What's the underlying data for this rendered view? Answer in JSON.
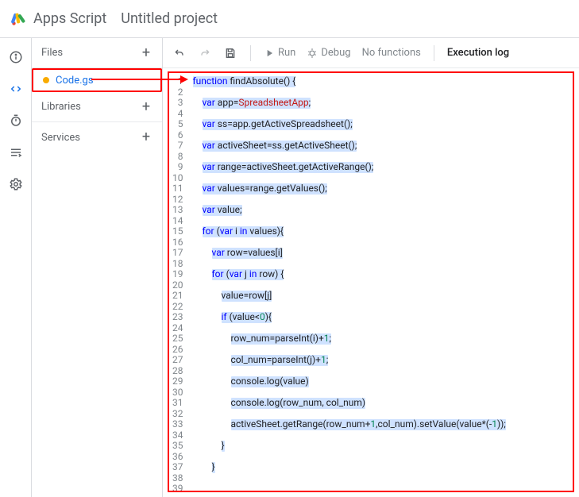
{
  "header": {
    "product": "Apps Script",
    "project_title": "Untitled project"
  },
  "sidebar": {
    "files_label": "Files",
    "file_name": "Code.gs",
    "libraries_label": "Libraries",
    "services_label": "Services"
  },
  "toolbar": {
    "run": "Run",
    "debug": "Debug",
    "no_functions": "No functions",
    "exec_log": "Execution log"
  },
  "code_lines": [
    {
      "indent": 0,
      "hl": true,
      "txt": "function findAbsolute() {"
    },
    {
      "indent": 0,
      "hl": false,
      "txt": ""
    },
    {
      "indent": 1,
      "hl": true,
      "txt": "var app=SpreadsheetApp;"
    },
    {
      "indent": 0,
      "hl": false,
      "txt": ""
    },
    {
      "indent": 1,
      "hl": true,
      "txt": "var ss=app.getActiveSpreadsheet();"
    },
    {
      "indent": 0,
      "hl": false,
      "txt": ""
    },
    {
      "indent": 1,
      "hl": true,
      "txt": "var activeSheet=ss.getActiveSheet();"
    },
    {
      "indent": 0,
      "hl": false,
      "txt": ""
    },
    {
      "indent": 1,
      "hl": true,
      "txt": "var range=activeSheet.getActiveRange();"
    },
    {
      "indent": 0,
      "hl": false,
      "txt": ""
    },
    {
      "indent": 1,
      "hl": true,
      "txt": "var values=range.getValues();"
    },
    {
      "indent": 0,
      "hl": false,
      "txt": ""
    },
    {
      "indent": 1,
      "hl": true,
      "txt": "var value;"
    },
    {
      "indent": 0,
      "hl": false,
      "txt": ""
    },
    {
      "indent": 1,
      "hl": true,
      "txt": "for (var i in values){"
    },
    {
      "indent": 1,
      "hl": false,
      "txt": ""
    },
    {
      "indent": 2,
      "hl": true,
      "txt": "var row=values[i]"
    },
    {
      "indent": 1,
      "hl": false,
      "txt": ""
    },
    {
      "indent": 2,
      "hl": true,
      "txt": "for (var j in row) {"
    },
    {
      "indent": 2,
      "hl": false,
      "txt": ""
    },
    {
      "indent": 3,
      "hl": true,
      "txt": "value=row[j]"
    },
    {
      "indent": 2,
      "hl": false,
      "txt": ""
    },
    {
      "indent": 3,
      "hl": true,
      "txt": "if (value<0){"
    },
    {
      "indent": 3,
      "hl": false,
      "txt": ""
    },
    {
      "indent": 4,
      "hl": true,
      "txt": "row_num=parseInt(i)+1;"
    },
    {
      "indent": 3,
      "hl": false,
      "txt": ""
    },
    {
      "indent": 4,
      "hl": true,
      "txt": "col_num=parseInt(j)+1;"
    },
    {
      "indent": 3,
      "hl": false,
      "txt": ""
    },
    {
      "indent": 4,
      "hl": true,
      "txt": "console.log(value)"
    },
    {
      "indent": 3,
      "hl": false,
      "txt": ""
    },
    {
      "indent": 4,
      "hl": true,
      "txt": "console.log(row_num, col_num)"
    },
    {
      "indent": 3,
      "hl": false,
      "txt": ""
    },
    {
      "indent": 4,
      "hl": true,
      "txt": "activeSheet.getRange(row_num+1,col_num).setValue(value*(-1));"
    },
    {
      "indent": 3,
      "hl": false,
      "txt": ""
    },
    {
      "indent": 3,
      "hl": true,
      "txt": "}"
    },
    {
      "indent": 2,
      "hl": false,
      "txt": ""
    },
    {
      "indent": 2,
      "hl": true,
      "txt": "}"
    },
    {
      "indent": 1,
      "hl": false,
      "txt": ""
    },
    {
      "indent": 1,
      "hl": false,
      "txt": ""
    }
  ]
}
